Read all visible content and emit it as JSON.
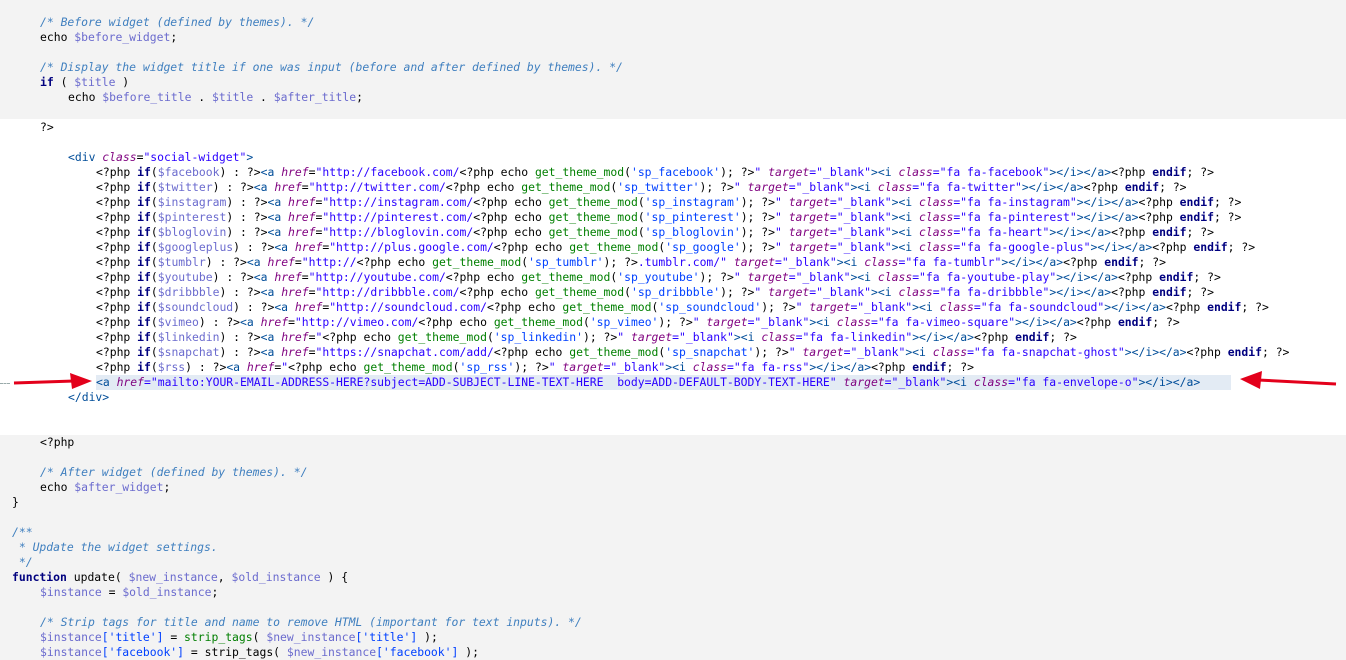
{
  "theme": {
    "background": "#f3f3f3",
    "html_region": "#ffffff",
    "arrow_color": "#e3001b"
  },
  "code": {
    "l1": "/* Before widget (defined by themes). */",
    "l2a": "echo ",
    "l2b": "$before_widget",
    "l2c": ";",
    "l4": "/* Display the widget title if one was input (before and after defined by themes). */",
    "l5a": "if",
    "l5b": " ( ",
    "l5c": "$title",
    "l5d": " )",
    "l6a": "echo ",
    "l6b": "$before_title",
    "l6c": " . ",
    "l6d": "$title",
    "l6e": " . ",
    "l6f": "$after_title",
    "l6g": ";",
    "l8": "?>",
    "div_open_a": "<div ",
    "div_open_b": "class",
    "div_open_c": "=",
    "div_open_d": "\"social-widget\"",
    "div_open_e": ">",
    "div_close": "</div>",
    "php_open": "<?php",
    "after_comment": "/* After widget (defined by themes). */",
    "echo_after_a": "echo ",
    "echo_after_b": "$after_widget",
    "echo_after_c": ";",
    "brace_close": "}",
    "doc1": "/**",
    "doc2": " * Update the widget settings.",
    "doc3": " */",
    "fn_a": "function",
    "fn_b": " update",
    "fn_c": "( ",
    "fn_d": "$new_instance",
    "fn_e": ", ",
    "fn_f": "$old_instance",
    "fn_g": " ) {",
    "inst_a": "$instance",
    "inst_b": " = ",
    "inst_c": "$old_instance",
    "inst_d": ";",
    "strip_comment": "/* Strip tags for title and name to remove HTML (important for text inputs). */",
    "strip1_a": "$instance",
    "strip1_b": "['title']",
    "strip1_c": " = ",
    "strip1_d": "strip_tags",
    "strip1_e": "( ",
    "strip1_f": "$new_instance",
    "strip1_g": "['title']",
    "strip1_h": " );",
    "strip2_a": "$instance",
    "strip2_b": "['facebook']",
    "strip2_c": " = strip_tags( ",
    "strip2_d": "$new_instance",
    "strip2_e": "['facebook']",
    "strip2_f": " );",
    "social": [
      {
        "var": "$facebook",
        "url": "http://facebook.com/",
        "mod": "'sp_facebook'",
        "icon": "\"fa fa-facebook\"",
        "q": "\""
      },
      {
        "var": "$twitter",
        "url": "http://twitter.com/",
        "mod": "'sp_twitter'",
        "icon": "\"fa fa-twitter\"",
        "q": "\""
      },
      {
        "var": "$instagram",
        "url": "http://instagram.com/",
        "mod": "'sp_instagram'",
        "icon": "\"fa fa-instagram\"",
        "q": "\""
      },
      {
        "var": "$pinterest",
        "url": "http://pinterest.com/",
        "mod": "'sp_pinterest'",
        "icon": "\"fa fa-pinterest\"",
        "q": "\""
      },
      {
        "var": "$bloglovin",
        "url": "http://bloglovin.com/",
        "mod": "'sp_bloglovin'",
        "icon": "\"fa fa-heart\"",
        "q": "\""
      },
      {
        "var": "$googleplus",
        "url": "http://plus.google.com/",
        "mod": "'sp_google'",
        "icon": "\"fa fa-google-plus\"",
        "q": "\""
      }
    ],
    "tumblr": {
      "pre": "<?php ",
      "k": "if",
      "p1": "(",
      "var": "$tumblr",
      "p2": ") : ?>",
      "tag": "<a ",
      "href": "href",
      "eq": "=",
      "u1": "\"http://",
      "php": "<?php echo ",
      "fn": "get_theme_mod",
      "arg": "('sp_tumblr');",
      "close": " ?>",
      ".tumblr.com/\"": ".tumblr.com/\"",
      "tgt": " target",
      "tv": "=\"_blank\"",
      "i": "><i ",
      "cls": "class",
      "cv": "=\"fa fa-tumblr\"",
      "end": "></i></a><?php ",
      "endif": "endif",
      "semi": "; ?>"
    },
    "social2": [
      {
        "var": "$youtube",
        "url": "http://youtube.com/",
        "mod": "'sp_youtube'",
        "icon": "\"fa fa-youtube-play\""
      },
      {
        "var": "$dribbble",
        "url": "http://dribbble.com/",
        "mod": "'sp_dribbble'",
        "icon": "\"fa fa-dribbble\""
      },
      {
        "var": "$soundcloud",
        "url": "http://soundcloud.com/",
        "mod": "'sp_soundcloud'",
        "icon": "\"fa fa-soundcloud\""
      },
      {
        "var": "$vimeo",
        "url": "http://vimeo.com/",
        "mod": "'sp_vimeo'",
        "icon": "\"fa fa-vimeo-square\""
      }
    ],
    "linkedin": {
      "var": "$linkedin",
      "mod": "'sp_linkedin'",
      "icon": "\"fa fa-linkedin\""
    },
    "snapchat": {
      "var": "$snapchat",
      "url": "https://snapchat.com/add/",
      "mod": "'sp_snapchat'",
      "icon": "\"fa fa-snapchat-ghost\""
    },
    "rss": {
      "var": "$rss",
      "mod": "'sp_rss'",
      "icon": "\"fa fa-rss\""
    },
    "mailto": {
      "tag": "<a ",
      "href": "href",
      "val": "=\"mailto:YOUR-EMAIL-ADDRESS-HERE?subject=ADD-SUBJECT-LINE-TEXT-HERE  body=ADD-DEFAULT-BODY-TEXT-HERE\"",
      "tgt": " target",
      "tv": "=\"_blank\"",
      "i": "><i ",
      "cls": "class",
      "cv": "=\"fa fa-envelope-o\"",
      "end": "></i></a>"
    }
  }
}
